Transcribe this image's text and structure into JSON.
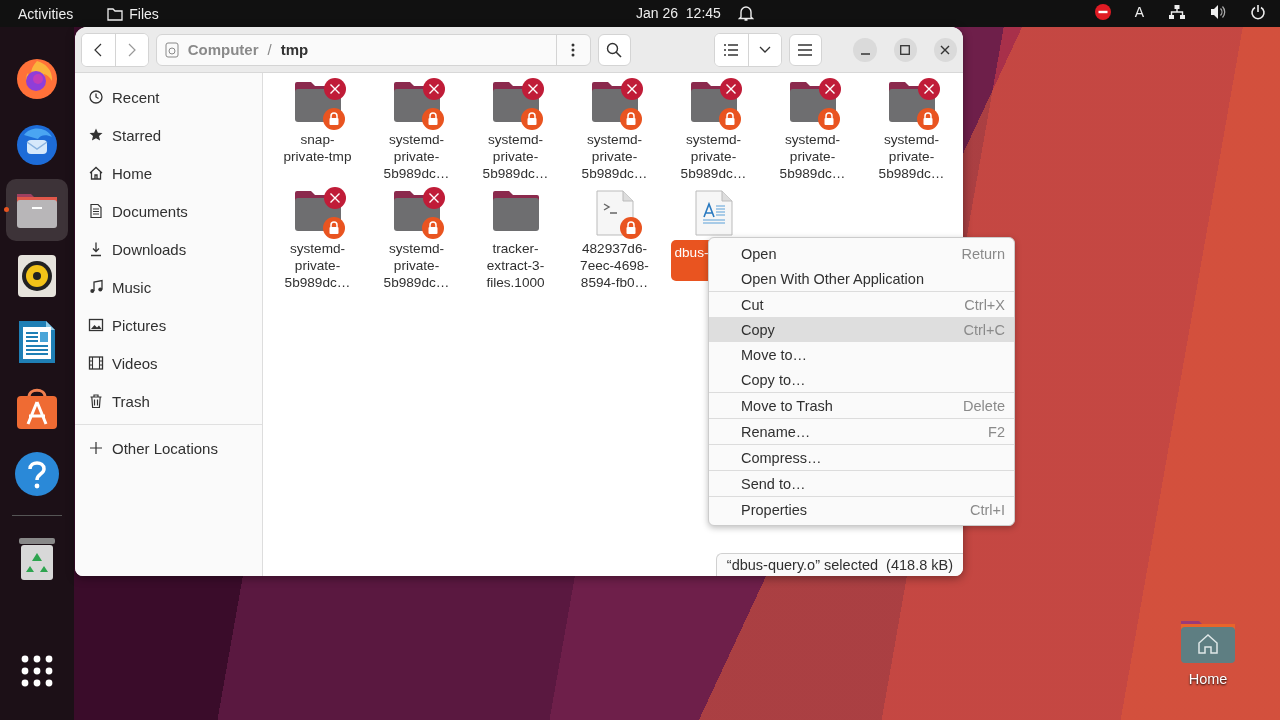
{
  "top_bar": {
    "activities": "Activities",
    "app_name": "Files",
    "clock": "Jan 26  12:45",
    "keyboard_layout": "A"
  },
  "dock": [
    {
      "kind": "firefox",
      "selected": false
    },
    {
      "kind": "thunderbird",
      "selected": false
    },
    {
      "kind": "files",
      "selected": true
    },
    {
      "kind": "rhythmbox",
      "selected": false
    },
    {
      "kind": "writer",
      "selected": false
    },
    {
      "kind": "software",
      "selected": false
    },
    {
      "kind": "help",
      "selected": false
    },
    {
      "kind": "trash",
      "selected": false
    },
    {
      "kind": "apps",
      "selected": false
    }
  ],
  "window": {
    "path": [
      {
        "label": "Computer",
        "selected": false
      },
      {
        "label": "tmp",
        "selected": true
      }
    ],
    "path_separator": "/"
  },
  "sidebar": {
    "items": [
      {
        "label": "Recent",
        "kind": "recent"
      },
      {
        "label": "Starred",
        "kind": "starred"
      },
      {
        "label": "Home",
        "kind": "home"
      },
      {
        "label": "Documents",
        "kind": "documents"
      },
      {
        "label": "Downloads",
        "kind": "downloads"
      },
      {
        "label": "Music",
        "kind": "music"
      },
      {
        "label": "Pictures",
        "kind": "pictures"
      },
      {
        "label": "Videos",
        "kind": "videos"
      },
      {
        "label": "Trash",
        "kind": "trash"
      }
    ],
    "other": {
      "label": "Other Locations",
      "kind": "other"
    }
  },
  "files": [
    {
      "name": "snap-private-tmp",
      "kind": "folder",
      "no_access": true,
      "locked": true,
      "selected": false
    },
    {
      "name": "systemd-private-5b989dc…",
      "kind": "folder",
      "no_access": true,
      "locked": true,
      "selected": false
    },
    {
      "name": "systemd-private-5b989dc…",
      "kind": "folder",
      "no_access": true,
      "locked": true,
      "selected": false
    },
    {
      "name": "systemd-private-5b989dc…",
      "kind": "folder",
      "no_access": true,
      "locked": true,
      "selected": false
    },
    {
      "name": "systemd-private-5b989dc…",
      "kind": "folder",
      "no_access": true,
      "locked": true,
      "selected": false
    },
    {
      "name": "systemd-private-5b989dc…",
      "kind": "folder",
      "no_access": true,
      "locked": true,
      "selected": false
    },
    {
      "name": "systemd-private-5b989dc…",
      "kind": "folder",
      "no_access": true,
      "locked": true,
      "selected": false
    },
    {
      "name": "systemd-private-5b989dc…",
      "kind": "folder",
      "no_access": true,
      "locked": true,
      "selected": false
    },
    {
      "name": "systemd-private-5b989dc…",
      "kind": "folder",
      "no_access": true,
      "locked": true,
      "selected": false
    },
    {
      "name": "tracker-extract-3-files.1000",
      "kind": "folder",
      "no_access": false,
      "locked": false,
      "selected": false
    },
    {
      "name": "482937d6-7eec-4698-8594-fb0…",
      "kind": "script",
      "no_access": false,
      "locked": true,
      "selected": false
    },
    {
      "name": "dbus-",
      "kind": "document",
      "no_access": false,
      "locked": false,
      "selected": true
    }
  ],
  "context_menu": [
    [
      {
        "label": "Open",
        "shortcut": "Return",
        "selected": false
      },
      {
        "label": "Open With Other Application",
        "selected": false
      }
    ],
    [
      {
        "label": "Cut",
        "shortcut": "Ctrl+X",
        "selected": false
      },
      {
        "label": "Copy",
        "shortcut": "Ctrl+C",
        "selected": true
      },
      {
        "label": "Move to…",
        "selected": false
      },
      {
        "label": "Copy to…",
        "selected": false
      }
    ],
    [
      {
        "label": "Move to Trash",
        "shortcut": "Delete",
        "selected": false
      }
    ],
    [
      {
        "label": "Rename…",
        "shortcut": "F2",
        "selected": false
      }
    ],
    [
      {
        "label": "Compress…",
        "selected": false
      }
    ],
    [
      {
        "label": "Send to…",
        "selected": false
      }
    ],
    [
      {
        "label": "Properties",
        "shortcut": "Ctrl+I",
        "selected": false
      }
    ]
  ],
  "status": "“dbus-query.o” selected  (418.8 kB)",
  "desktop_icons": [
    {
      "label": "Home",
      "kind": "home-folder"
    }
  ]
}
